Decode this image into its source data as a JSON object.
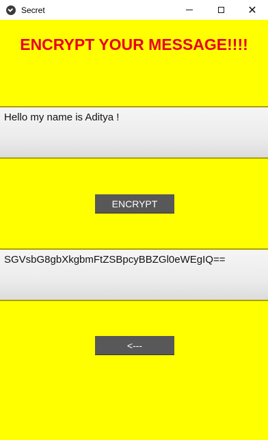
{
  "window": {
    "title": "Secret",
    "background_color": "#ffff00"
  },
  "header": {
    "title": "ENCRYPT YOUR MESSAGE!!!!",
    "color": "#e8001c"
  },
  "input": {
    "value": "Hello my name is Aditya !"
  },
  "encrypt_button": {
    "label": "ENCRYPT"
  },
  "output": {
    "value": "SGVsbG8gbXkgbmFtZSBpcyBBZGl0eWEgIQ=="
  },
  "back_button": {
    "label": "<---"
  },
  "controls": {
    "minimize_icon": "minimize-icon",
    "maximize_icon": "maximize-icon",
    "close_icon": "close-icon",
    "close_glyph": "✕"
  }
}
